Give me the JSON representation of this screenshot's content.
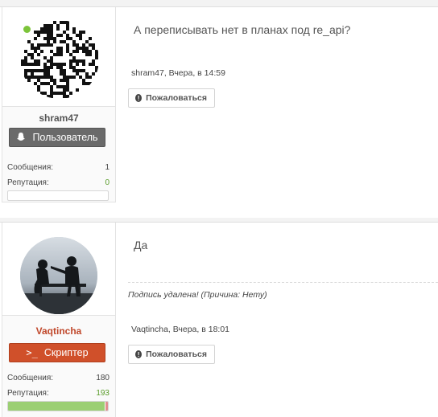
{
  "posts": [
    {
      "author": "shram47",
      "online": true,
      "rank": "Пользователь",
      "rank_icon": "snapchat-ghost-icon",
      "stats": [
        {
          "label": "Сообщения:",
          "value": "1"
        },
        {
          "label": "Репутация:",
          "value": "0"
        }
      ],
      "reputation_fill": 0,
      "message": "А переписывать нет в планах под re_api?",
      "meta": "shram47, Вчера, в 14:59",
      "report_label": "Пожаловаться"
    },
    {
      "author": "Vaqtincha",
      "online": false,
      "rank": "Скриптер",
      "rank_icon": "terminal-icon",
      "stats": [
        {
          "label": "Сообщения:",
          "value": "180"
        },
        {
          "label": "Репутация:",
          "value": "193"
        }
      ],
      "reputation_fill": 0.97,
      "message": "Да",
      "signature": "Подпись удалена! (Причина: Нету)",
      "meta": "Vaqtincha, Вчера, в 18:01",
      "report_label": "Пожаловаться"
    }
  ],
  "colors": {
    "online": "#7cc43a",
    "rank_user": "#6a6a6a",
    "rank_scripter": "#d0502a",
    "username_scripter": "#c0472a",
    "reputation_positive": "#5a9c2a",
    "reputation_bar": "#9bcf73"
  }
}
